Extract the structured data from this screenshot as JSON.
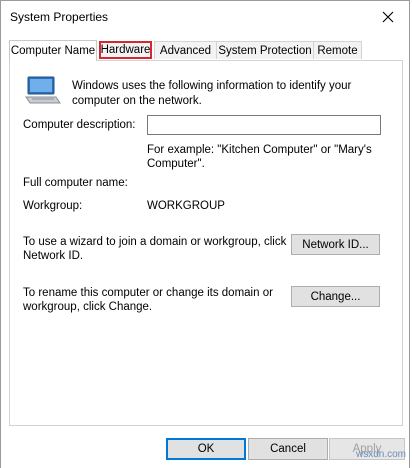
{
  "window": {
    "title": "System Properties"
  },
  "tabs": [
    {
      "label": "Computer Name",
      "active": true
    },
    {
      "label": "Hardware",
      "highlighted": true
    },
    {
      "label": "Advanced"
    },
    {
      "label": "System Protection"
    },
    {
      "label": "Remote"
    }
  ],
  "panel": {
    "info_text": "Windows uses the following information to identify your computer on the network.",
    "description_label": "Computer description:",
    "description_value": "",
    "example_text": "For example: \"Kitchen Computer\" or \"Mary's Computer\".",
    "full_name_label": "Full computer name:",
    "full_name_value": "",
    "workgroup_label": "Workgroup:",
    "workgroup_value": "WORKGROUP",
    "network_id_text": "To use a wizard to join a domain or workgroup, click Network ID.",
    "network_id_button": "Network ID...",
    "rename_text": "To rename this computer or change its domain or workgroup, click Change.",
    "change_button": "Change..."
  },
  "footer": {
    "ok_button": "OK",
    "cancel_button": "Cancel",
    "apply_button": "Apply"
  },
  "colors": {
    "highlight_border": "#d7262e",
    "default_button_border": "#0078d7"
  },
  "watermark": "wsxdn.com"
}
